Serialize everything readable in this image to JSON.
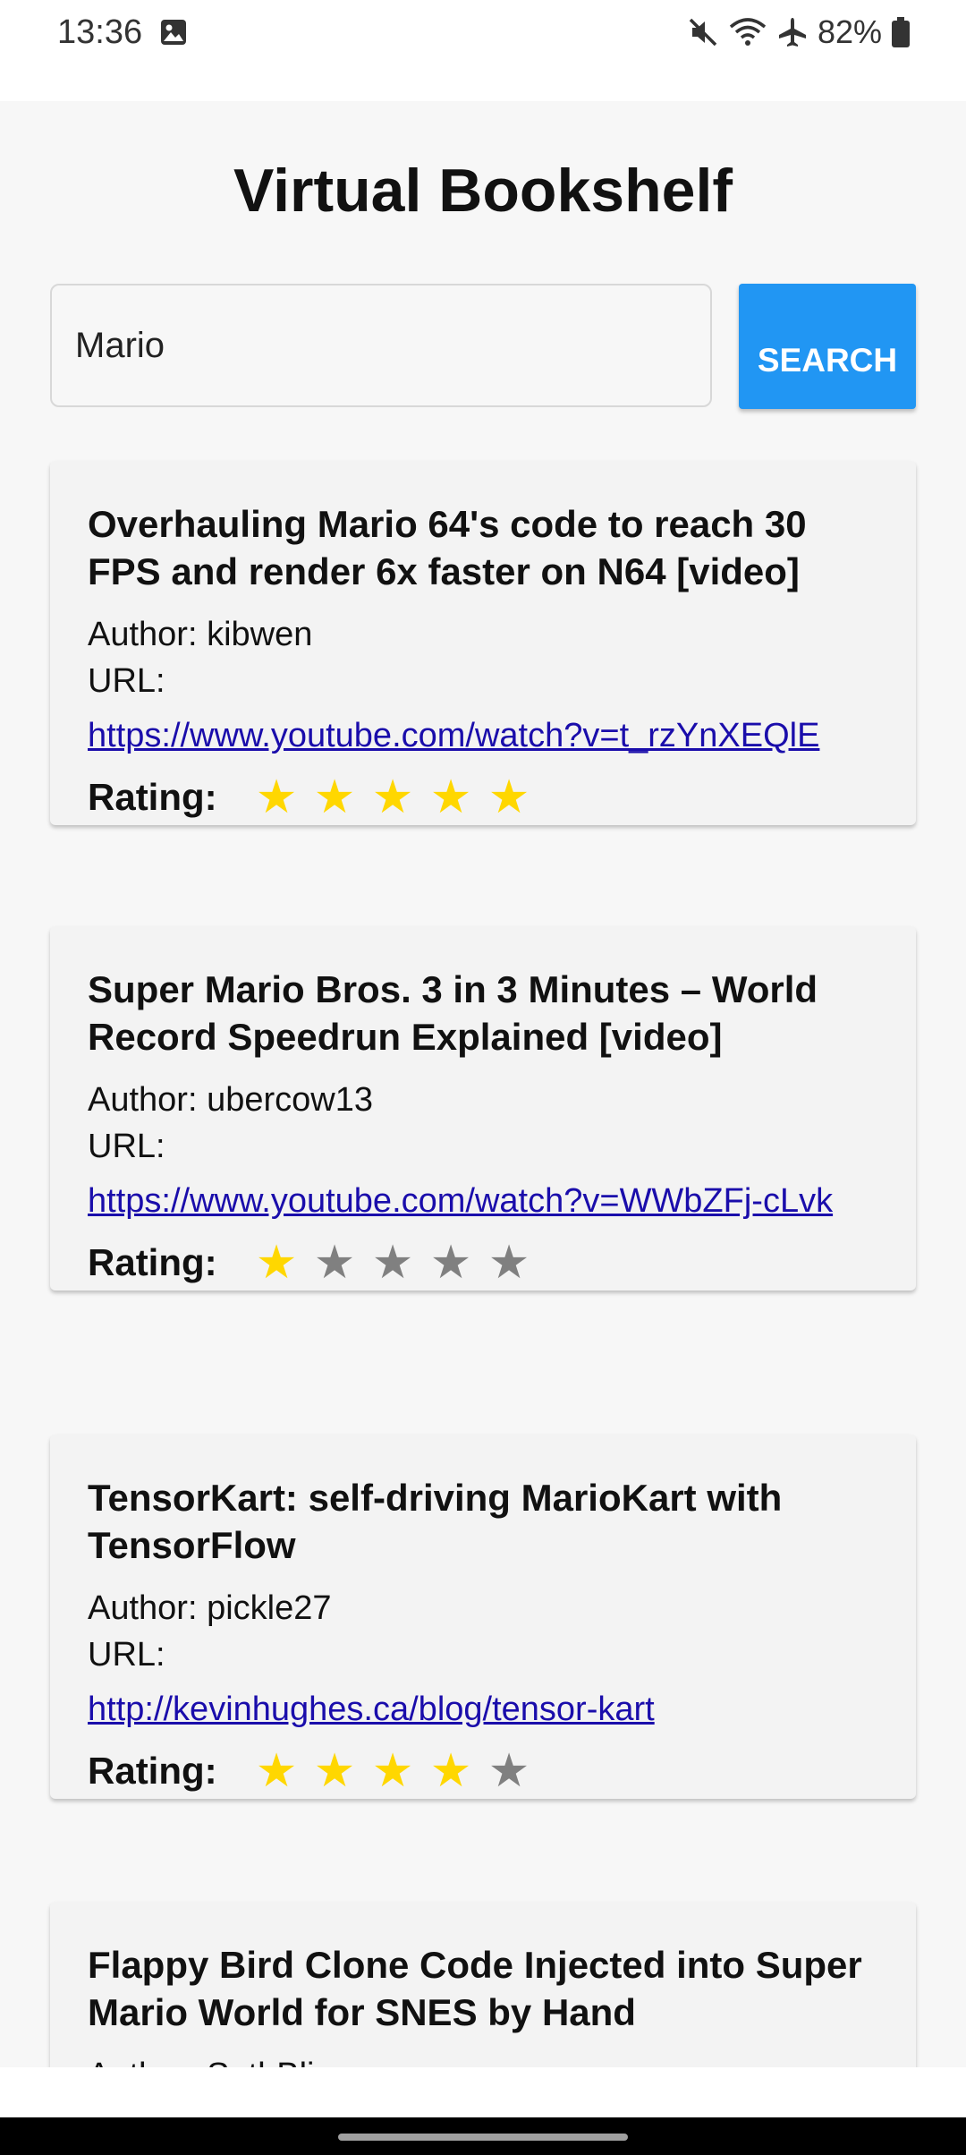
{
  "status_bar": {
    "time": "13:36",
    "battery_percent": "82%",
    "icons": [
      "gallery-icon",
      "mute-icon",
      "wifi-icon",
      "airplane-icon",
      "battery-icon"
    ]
  },
  "app": {
    "title": "Virtual Bookshelf",
    "search": {
      "value": "Mario",
      "button_label": "SEARCH"
    },
    "accent_color": "#2196f3",
    "star_on_color": "#ffd700",
    "star_off_color": "#808080",
    "rating_label": "Rating:",
    "author_prefix": "Author: ",
    "url_label": "URL:"
  },
  "results": [
    {
      "title": "Overhauling Mario 64's code to reach 30 FPS and render 6x faster on N64 [video]",
      "author": "Author: kibwen",
      "url": "https://www.youtube.com/watch?v=t_rzYnXEQlE",
      "rating": 5
    },
    {
      "title": "Super Mario Bros. 3 in 3 Minutes – World Record Speedrun Explained [video]",
      "author": "Author: ubercow13",
      "url": "https://www.youtube.com/watch?v=WWbZFj-cLvk",
      "rating": 1
    },
    {
      "title": "TensorKart: self-driving MarioKart with TensorFlow",
      "author": "Author: pickle27",
      "url": "http://kevinhughes.ca/blog/tensor-kart",
      "rating": 4
    },
    {
      "title": "Flappy Bird Clone Code Injected into Super Mario World for SNES by Hand",
      "author": "Author: SethBling",
      "url": "",
      "rating": 0
    }
  ],
  "max_rating": 5
}
